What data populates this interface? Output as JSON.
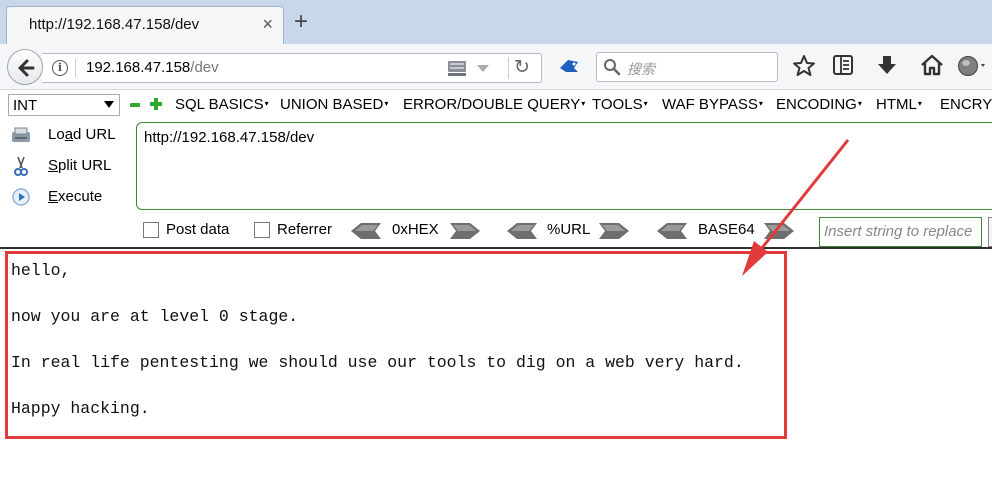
{
  "tab": {
    "title": "http://192.168.47.158/dev",
    "close": "×",
    "new_tab": "+"
  },
  "navbar": {
    "url_host": "192.168.47.158",
    "url_path": "/dev",
    "search_placeholder": "搜索",
    "info_glyph": "i",
    "reload_glyph": "↻"
  },
  "hackbar": {
    "type_select": "INT",
    "menu": [
      "SQL BASICS",
      "UNION BASED",
      "ERROR/DOUBLE QUERY",
      "TOOLS",
      "WAF BYPASS",
      "ENCODING",
      "HTML",
      "ENCRYPTION"
    ],
    "menu_arrow": "▾",
    "load_url": {
      "pre": "Lo",
      "ul": "a",
      "post": "d URL"
    },
    "split_url": {
      "pre": "",
      "ul": "S",
      "post": "plit URL"
    },
    "execute": {
      "pre": "",
      "ul": "E",
      "post": "xecute"
    },
    "url_value": "http://192.168.47.158/dev",
    "post_data": "Post data",
    "referrer": "Referrer",
    "hex": "0xHEX",
    "url_enc": "%URL",
    "base64": "BASE64",
    "replace_placeholder": "Insert string to replace"
  },
  "content": {
    "lines": [
      "hello,",
      "now you are at level 0 stage.",
      "In real life pentesting we should use our tools to dig on a web very hard.",
      "Happy hacking."
    ]
  },
  "colors": {
    "highlight": "#e23a3a",
    "hackbar_green": "#2eaa2e"
  }
}
